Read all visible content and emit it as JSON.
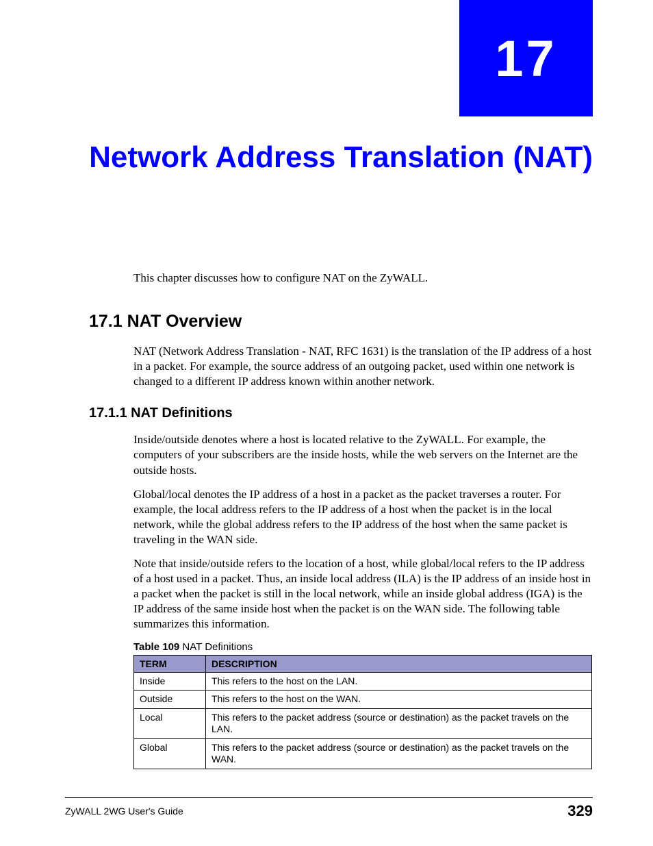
{
  "chapter": {
    "number": "17",
    "title": "Network Address Translation (NAT)"
  },
  "intro": "This chapter discusses how to configure NAT on the ZyWALL.",
  "section_17_1": {
    "heading": "17.1  NAT Overview",
    "body": "NAT (Network Address Translation - NAT, RFC 1631) is the translation of the IP address of a host in a packet. For example, the source address of an outgoing packet, used within one network is changed to a different IP address known within another network."
  },
  "section_17_1_1": {
    "heading": "17.1.1  NAT Definitions",
    "para1": "Inside/outside denotes where a host is located relative to the ZyWALL. For example, the computers of your subscribers are the inside hosts, while the web servers on the Internet are the outside hosts.",
    "para2": "Global/local denotes the IP address of a host in a packet as the packet traverses a router. For example, the local address refers to the IP address of a host when the packet is in the local network, while the global address refers to the IP address of the host when the same packet is traveling in the WAN side.",
    "para3": "Note that inside/outside refers to the location of a host, while global/local refers to the IP address of a host used in a packet. Thus, an inside local address (ILA) is the IP address of an inside host in a packet when the packet is still in the local network, while an inside global address (IGA) is the IP address of the same inside host when the packet is on the WAN side. The following table summarizes this information."
  },
  "table": {
    "caption_bold": "Table 109",
    "caption_text": "   NAT Definitions",
    "headers": {
      "term": "TERM",
      "desc": "DESCRIPTION"
    },
    "rows": [
      {
        "term": "Inside",
        "desc": "This refers to the host on the LAN."
      },
      {
        "term": "Outside",
        "desc": "This refers to the host on the WAN."
      },
      {
        "term": "Local",
        "desc": "This refers to the packet address (source or destination) as the packet travels on the LAN."
      },
      {
        "term": "Global",
        "desc": "This refers to the packet address (source or destination) as the packet travels on the WAN."
      }
    ]
  },
  "footer": {
    "guide": "ZyWALL 2WG User's Guide",
    "page": "329"
  }
}
